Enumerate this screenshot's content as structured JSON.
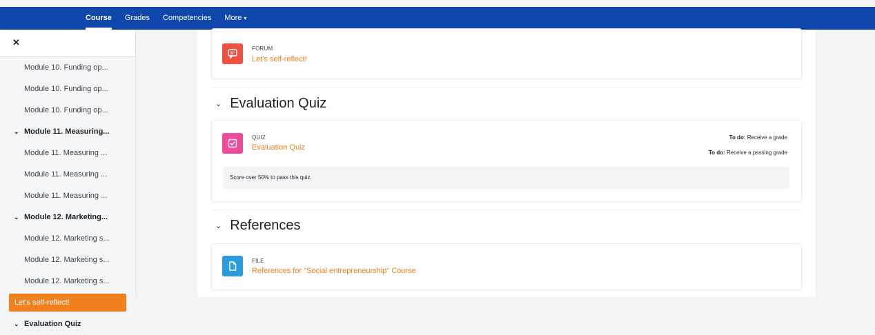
{
  "nav": {
    "tabs": [
      {
        "label": "Course",
        "active": true
      },
      {
        "label": "Grades",
        "active": false
      },
      {
        "label": "Competencies",
        "active": false
      },
      {
        "label": "More",
        "active": false
      }
    ]
  },
  "drawer": {
    "close_icon": "close-icon",
    "items": [
      {
        "label": "Module 10. Funding op...",
        "type": "activity"
      },
      {
        "label": "Module 10. Funding op...",
        "type": "activity"
      },
      {
        "label": "Module 10. Funding op...",
        "type": "activity"
      },
      {
        "label": "Module 11. Measuring...",
        "type": "section"
      },
      {
        "label": "Module 11. Measuring ...",
        "type": "activity"
      },
      {
        "label": "Module 11. Measuring ...",
        "type": "activity"
      },
      {
        "label": "Module 11. Measuring ...",
        "type": "activity"
      },
      {
        "label": "Module 12. Marketing...",
        "type": "section"
      },
      {
        "label": "Module 12. Marketing s...",
        "type": "activity"
      },
      {
        "label": "Module 12. Marketing s...",
        "type": "activity"
      },
      {
        "label": "Module 12. Marketing s...",
        "type": "activity"
      },
      {
        "label": "Let's self-reflect!",
        "type": "active"
      },
      {
        "label": "Evaluation Quiz",
        "type": "section"
      }
    ]
  },
  "main": {
    "forum": {
      "type": "FORUM",
      "name": "Let's self-reflect!",
      "icon": "forum-icon",
      "color": "#f0503f"
    },
    "quiz_section": {
      "title": "Evaluation Quiz",
      "activity": {
        "type": "QUIZ",
        "name": "Evaluation Quiz",
        "icon": "quiz-icon",
        "color": "#ec4c9a"
      },
      "todo_1_label": "To do:",
      "todo_1_text": "Receive a grade",
      "todo_2_label": "To do:",
      "todo_2_text": "Receive a passing grade",
      "restriction": "Score over 50% to pass this quiz."
    },
    "references_section": {
      "title": "References",
      "activity": {
        "type": "FILE",
        "name": "References for \"Social entrepreneurship\" Course",
        "icon": "file-icon",
        "color": "#2d9cdb"
      }
    }
  },
  "colors": {
    "brand": "#0f47ad",
    "accent": "#f07f1e"
  }
}
